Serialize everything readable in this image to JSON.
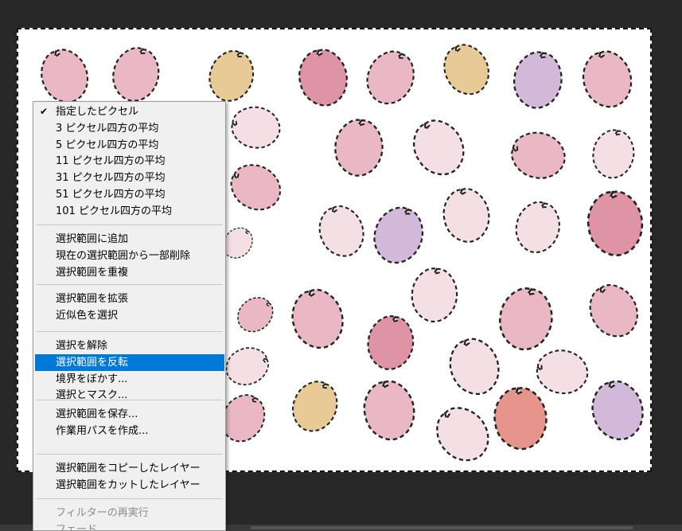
{
  "context_menu": {
    "groups": [
      [
        {
          "label": "指定したピクセル",
          "checked": true,
          "highlighted": false,
          "disabled": false
        },
        {
          "label": "3 ピクセル四方の平均",
          "checked": false,
          "highlighted": false,
          "disabled": false
        },
        {
          "label": "5 ピクセル四方の平均",
          "checked": false,
          "highlighted": false,
          "disabled": false
        },
        {
          "label": "11 ピクセル四方の平均",
          "checked": false,
          "highlighted": false,
          "disabled": false
        },
        {
          "label": "31 ピクセル四方の平均",
          "checked": false,
          "highlighted": false,
          "disabled": false
        },
        {
          "label": "51 ピクセル四方の平均",
          "checked": false,
          "highlighted": false,
          "disabled": false
        },
        {
          "label": "101 ピクセル四方の平均",
          "checked": false,
          "highlighted": false,
          "disabled": false
        }
      ],
      [
        {
          "label": "選択範囲に追加",
          "checked": false,
          "highlighted": false,
          "disabled": false
        },
        {
          "label": "現在の選択範囲から一部削除",
          "checked": false,
          "highlighted": false,
          "disabled": false
        },
        {
          "label": "選択範囲を重複",
          "checked": false,
          "highlighted": false,
          "disabled": false
        }
      ],
      [
        {
          "label": "選択範囲を拡張",
          "checked": false,
          "highlighted": false,
          "disabled": false
        },
        {
          "label": "近似色を選択",
          "checked": false,
          "highlighted": false,
          "disabled": false
        }
      ],
      [
        {
          "label": "選択を解除",
          "checked": false,
          "highlighted": false,
          "disabled": false
        },
        {
          "label": "選択範囲を反転",
          "checked": false,
          "highlighted": true,
          "disabled": false
        },
        {
          "label": "境界をぼかす...",
          "checked": false,
          "highlighted": false,
          "disabled": false
        },
        {
          "label": "選択とマスク...",
          "checked": false,
          "highlighted": false,
          "disabled": false
        }
      ],
      [
        {
          "label": "選択範囲を保存...",
          "checked": false,
          "highlighted": false,
          "disabled": false
        },
        {
          "label": "作業用パスを作成...",
          "checked": false,
          "highlighted": false,
          "disabled": false
        }
      ],
      [
        {
          "label": "選択範囲をコピーしたレイヤー",
          "checked": false,
          "highlighted": false,
          "disabled": false
        },
        {
          "label": "選択範囲をカットしたレイヤー",
          "checked": false,
          "highlighted": false,
          "disabled": false
        }
      ],
      [
        {
          "label": "フィルターの再実行",
          "checked": false,
          "highlighted": false,
          "disabled": true
        },
        {
          "label": "フェード",
          "checked": false,
          "highlighted": false,
          "disabled": true
        }
      ]
    ]
  },
  "colors": {
    "highlight": "#0078d7",
    "petal_pink": "#e9b3c1",
    "petal_light": "#f4dde3",
    "petal_rose": "#dc8c9e",
    "petal_gold": "#e6c68e",
    "petal_lilac": "#cfb2d6",
    "petal_coral": "#e58b83"
  },
  "icons": {
    "check": "checkmark-icon"
  }
}
